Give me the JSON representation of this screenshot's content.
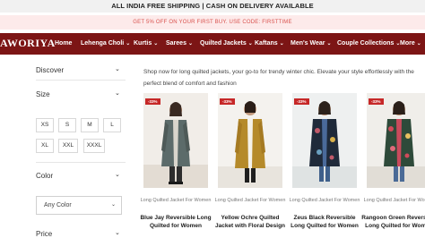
{
  "announcement": "ALL INDIA FREE SHIPPING | CASH ON DELIVERY AVAILABLE",
  "promo": "GET 5% OFF ON YOUR FIRST BUY. USE CODE: FIRSTTIME",
  "brand": "AWORIYA",
  "nav": [
    {
      "label": "Home",
      "has_dropdown": false
    },
    {
      "label": "Lehenga Choli",
      "has_dropdown": true
    },
    {
      "label": "Kurtis",
      "has_dropdown": true
    },
    {
      "label": "Sarees",
      "has_dropdown": true
    },
    {
      "label": "Quilted Jackets",
      "has_dropdown": true
    },
    {
      "label": "Kaftans",
      "has_dropdown": true
    },
    {
      "label": "Men's Wear",
      "has_dropdown": true
    },
    {
      "label": "Couple Collections",
      "has_dropdown": true
    },
    {
      "label": "More",
      "has_dropdown": true
    }
  ],
  "filters": {
    "discover": "Discover",
    "size": "Size",
    "sizes": [
      "XS",
      "S",
      "M",
      "L",
      "XL",
      "XXL",
      "XXXL"
    ],
    "color": "Color",
    "color_value": "Any Color",
    "price": "Price"
  },
  "description": "Shop now for long quilted jackets, your go-to for trendy winter chic. Elevate your style effortlessly with the perfect blend of comfort and fashion",
  "products": [
    {
      "discount": "-33%",
      "category": "Long Quilted Jacket For Women",
      "title": "Blue Jay Reversible Long Quilted for Women"
    },
    {
      "discount": "-33%",
      "category": "Long Quilted Jacket For Women",
      "title": "Yellow Ochre Quilted Jacket with Floral Design"
    },
    {
      "discount": "-33%",
      "category": "Long Quilted Jacket For Women",
      "title": "Zeus Black Reversible Long Quilted for Women"
    },
    {
      "discount": "-33%",
      "category": "Long Quilted Jacket For Women",
      "title": "Rangoon Green Reversible Long Quilted for Women"
    }
  ],
  "colors": {
    "nav_bg": "#7c1515",
    "promo_bg": "#fdeaea",
    "promo_text": "#d9534f",
    "badge": "#c62828"
  },
  "icons": {
    "dropdown": "chevron-down-icon"
  }
}
